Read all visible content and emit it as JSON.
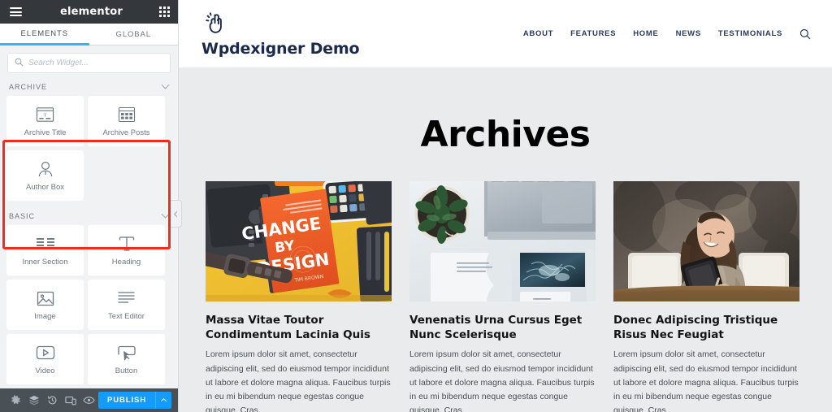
{
  "panel": {
    "brand": "elementor",
    "menu_icon": "hamburger-icon",
    "apps_icon": "grid-apps-icon",
    "tabs": [
      {
        "label": "ELEMENTS",
        "active": true
      },
      {
        "label": "GLOBAL",
        "active": false
      }
    ],
    "search": {
      "placeholder": "Search Widget...",
      "value": "",
      "icon": "search-icon"
    },
    "categories": [
      {
        "label": "ARCHIVE",
        "collapsed": false,
        "highlighted": true,
        "widgets": [
          {
            "label": "Archive Title",
            "icon": "archive-title-icon"
          },
          {
            "label": "Archive Posts",
            "icon": "archive-posts-icon"
          },
          {
            "label": "Author Box",
            "icon": "author-box-icon"
          }
        ]
      },
      {
        "label": "BASIC",
        "collapsed": false,
        "highlighted": false,
        "widgets": [
          {
            "label": "Inner Section",
            "icon": "inner-section-icon"
          },
          {
            "label": "Heading",
            "icon": "heading-icon"
          },
          {
            "label": "Image",
            "icon": "image-icon"
          },
          {
            "label": "Text Editor",
            "icon": "text-editor-icon"
          },
          {
            "label": "Video",
            "icon": "video-icon"
          },
          {
            "label": "Button",
            "icon": "button-icon"
          }
        ]
      }
    ],
    "footer": {
      "icons": [
        {
          "name": "settings-gear-icon",
          "title": "Settings"
        },
        {
          "name": "navigator-layers-icon",
          "title": "Navigator"
        },
        {
          "name": "history-revisions-icon",
          "title": "History"
        },
        {
          "name": "responsive-mode-icon",
          "title": "Responsive Mode"
        },
        {
          "name": "preview-eye-icon",
          "title": "Preview Changes"
        }
      ],
      "publish_label": "PUBLISH",
      "publish_caret": "chevron-up-icon",
      "publish_color": "#149cfc"
    },
    "collapse_handle": "chevron-left-icon",
    "highlight_color": "#f6291a"
  },
  "preview": {
    "site": {
      "logo_icon": "pointing-hand-icon",
      "title": "Wpdexigner Demo",
      "nav": [
        {
          "label": "ABOUT"
        },
        {
          "label": "FEATURES"
        },
        {
          "label": "HOME"
        },
        {
          "label": "NEWS"
        },
        {
          "label": "TESTIMONIALS"
        }
      ],
      "search_icon": "search-icon"
    },
    "page_heading": "Archives",
    "posts": [
      {
        "image_alt": "Flat-lay desk with orange book titled CHANGE BY DESIGN, drawing tablet, smartwatch and phone on a yellow background",
        "title": "Massa Vitae Toutor Condimentum Lacinia Quis",
        "excerpt": "Lorem ipsum dolor sit amet, consectetur adipiscing elit, sed do eiusmod tempor incididunt ut labore et dolore magna aliqua. Faucibus turpis in eu mi bibendum neque egestas congue quisque. Cras"
      },
      {
        "image_alt": "Overhead view of a silver laptop, potted plant and printed design brochures on a white desk",
        "title": "Venenatis Urna Cursus Eget Nunc Scelerisque",
        "excerpt": "Lorem ipsum dolor sit amet, consectetur adipiscing elit, sed do eiusmod tempor incididunt ut labore et dolore magna aliqua. Faucibus turpis in eu mi bibendum neque egestas congue quisque. Cras"
      },
      {
        "image_alt": "Smiling woman with long dark hair holding a tablet while seated at a wooden table",
        "title": "Donec Adipiscing Tristique Risus Nec Feugiat",
        "excerpt": "Lorem ipsum dolor sit amet, consectetur adipiscing elit, sed do eiusmod tempor incididunt ut labore et dolore magna aliqua. Faucibus turpis in eu mi bibendum neque egestas congue quisque. Cras"
      }
    ]
  }
}
